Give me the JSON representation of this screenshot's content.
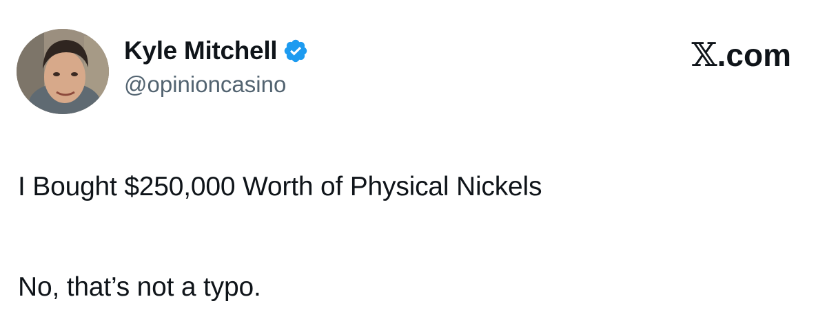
{
  "author": {
    "display_name": "Kyle Mitchell",
    "handle": "@opinioncasino",
    "verified": true,
    "verified_icon": "verified-badge-icon",
    "avatar": "profile-photo"
  },
  "site": {
    "x_glyph": "𝕏",
    "suffix": ".com"
  },
  "tweet": {
    "lines": [
      "I Bought $250,000 Worth of Physical Nickels",
      "No, that’s not a typo."
    ]
  },
  "colors": {
    "verified_blue": "#1d9bf0",
    "text_primary": "#0f1419",
    "text_secondary": "#536471"
  }
}
